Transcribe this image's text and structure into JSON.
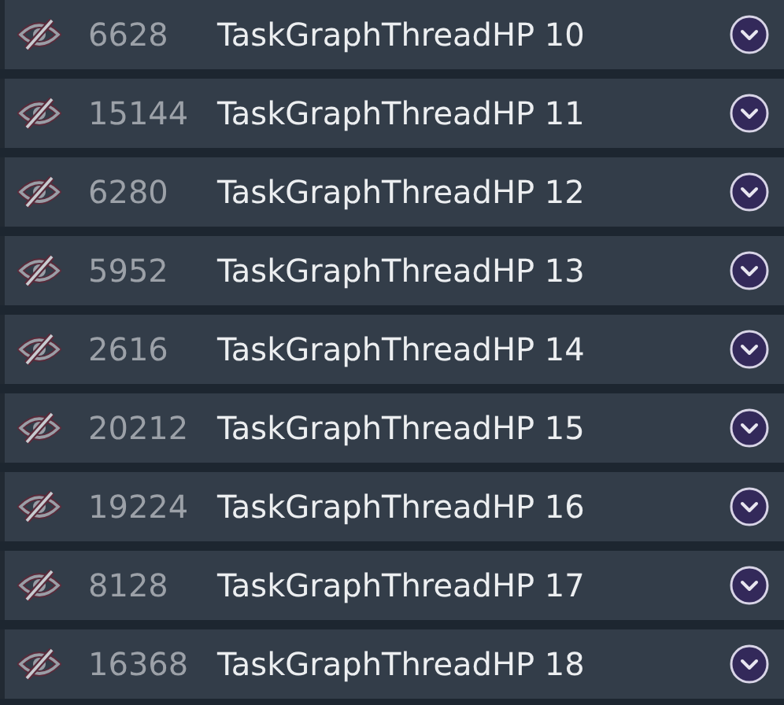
{
  "threads": [
    {
      "hidden": true,
      "id": "6628",
      "name": "TaskGraphThreadHP 10"
    },
    {
      "hidden": true,
      "id": "15144",
      "name": "TaskGraphThreadHP 11"
    },
    {
      "hidden": true,
      "id": "6280",
      "name": "TaskGraphThreadHP 12"
    },
    {
      "hidden": true,
      "id": "5952",
      "name": "TaskGraphThreadHP 13"
    },
    {
      "hidden": true,
      "id": "2616",
      "name": "TaskGraphThreadHP 14"
    },
    {
      "hidden": true,
      "id": "20212",
      "name": "TaskGraphThreadHP 15"
    },
    {
      "hidden": true,
      "id": "19224",
      "name": "TaskGraphThreadHP 16"
    },
    {
      "hidden": true,
      "id": "8128",
      "name": "TaskGraphThreadHP 17"
    },
    {
      "hidden": true,
      "id": "16368",
      "name": "TaskGraphThreadHP 18"
    }
  ]
}
